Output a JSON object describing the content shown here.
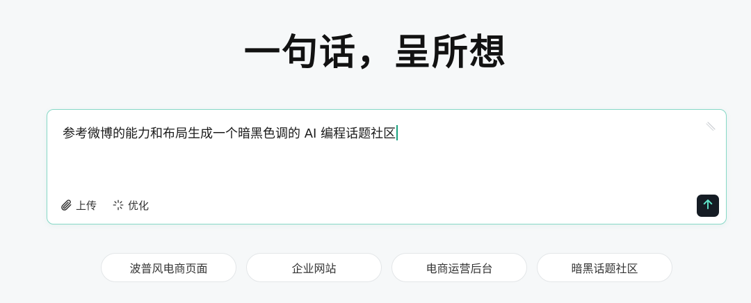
{
  "hero": {
    "title": "一句话，呈所想"
  },
  "composer": {
    "prompt_value": "参考微博的能力和布局生成一个暗黑色调的 AI 编程话题社区",
    "upload_label": "上传",
    "optimize_label": "优化",
    "icons": {
      "upload": "paperclip-icon",
      "optimize": "sparkle-icon",
      "send": "arrow-up-icon",
      "resize": "resize-handle-icon"
    }
  },
  "suggestions": [
    {
      "label": "波普风电商页面"
    },
    {
      "label": "企业网站"
    },
    {
      "label": "电商运营后台"
    },
    {
      "label": "暗黑话题社区"
    }
  ],
  "colors": {
    "accent_border": "#86d8c6",
    "caret": "#1aa17f",
    "send_bg": "#151c24",
    "send_arrow": "#5fe3c8",
    "page_bg": "#f6f8f9"
  }
}
